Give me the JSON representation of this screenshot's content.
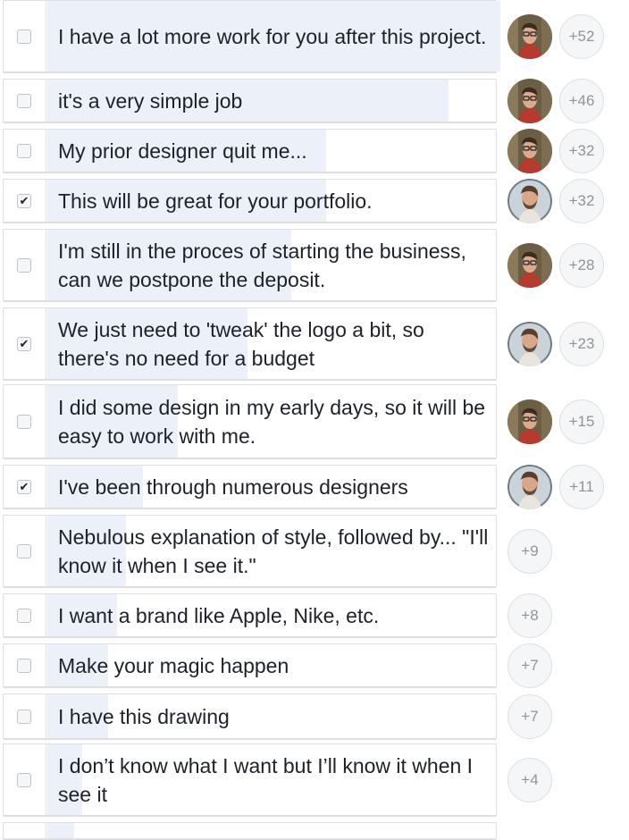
{
  "poll": {
    "options": [
      {
        "text": "I have a lot more work for you after this project.",
        "checked": false,
        "votes": "+52",
        "avatar": "man-with-glasses"
      },
      {
        "text": "it's a very simple job",
        "checked": false,
        "votes": "+46",
        "avatar": "man-with-glasses"
      },
      {
        "text": "My prior designer quit me...",
        "checked": false,
        "votes": "+32",
        "avatar": "man-with-glasses"
      },
      {
        "text": "This will be great for your portfolio.",
        "checked": true,
        "votes": "+32",
        "avatar": "bearded-man"
      },
      {
        "text": "I'm still in the proces of starting the business, can we postpone the deposit.",
        "checked": false,
        "votes": "+28",
        "avatar": "man-with-glasses"
      },
      {
        "text": "We just need to 'tweak' the logo a bit, so there's no need for a budget",
        "checked": true,
        "votes": "+23",
        "avatar": "bearded-man"
      },
      {
        "text": "I did some design in my early days, so it will be easy to work with me.",
        "checked": false,
        "votes": "+15",
        "avatar": "man-with-glasses"
      },
      {
        "text": "I've been through numerous designers",
        "checked": true,
        "votes": "+11",
        "avatar": "bearded-man"
      },
      {
        "text": "Nebulous explanation of style, followed by... \"I'll know it when I see it.\"",
        "checked": false,
        "votes": "+9",
        "avatar": ""
      },
      {
        "text": "I want a brand like Apple, Nike, etc.",
        "checked": false,
        "votes": "+8",
        "avatar": ""
      },
      {
        "text": "Make your magic happen",
        "checked": false,
        "votes": "+7",
        "avatar": ""
      },
      {
        "text": "I have this drawing",
        "checked": false,
        "votes": "+7",
        "avatar": ""
      },
      {
        "text": "I don’t know what I want but I’ll know it when I see it",
        "checked": false,
        "votes": "+4",
        "avatar": ""
      }
    ],
    "vote_shares": [
      1.0,
      0.885,
      0.615,
      0.615,
      0.538,
      0.442,
      0.288,
      0.212,
      0.173,
      0.154,
      0.135,
      0.135,
      0.077
    ],
    "colors": {
      "bar": "#ecf0f8",
      "border": "#dddfe2",
      "text": "#1d2129",
      "count": "#90949c"
    }
  }
}
